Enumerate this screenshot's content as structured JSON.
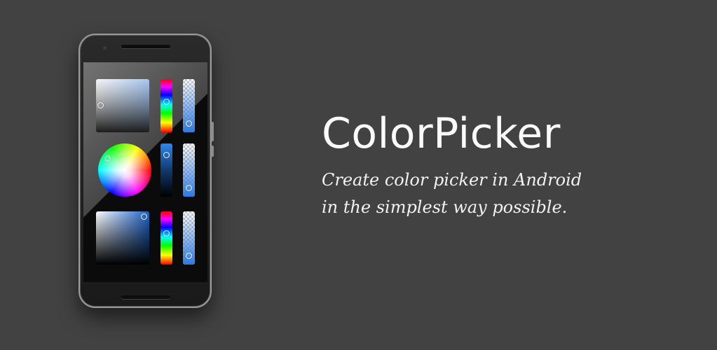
{
  "banner": {
    "title": "ColorPicker",
    "tagline_line1": "Create color picker in Android",
    "tagline_line2": "in the simplest way possible."
  },
  "colors": {
    "background": "#424242",
    "title_text": "#fafafa",
    "accent_blue": "#2f7ae0"
  },
  "phone_mockup": {
    "pickers": [
      {
        "style": "square",
        "hue_slider": "rainbow",
        "alpha_slider": "blue",
        "hue_level": 0.45,
        "alpha_level": 0.82
      },
      {
        "style": "wheel",
        "value_slider": "blue-to-black",
        "alpha_slider": "blue",
        "value_level": 0.2,
        "alpha_level": 0.82
      },
      {
        "style": "square",
        "hue_slider": "rainbow",
        "alpha_slider": "blue",
        "hue_level": 0.42,
        "alpha_level": 0.82
      }
    ],
    "icons": [
      "front-camera-icon",
      "speaker-icon"
    ]
  }
}
